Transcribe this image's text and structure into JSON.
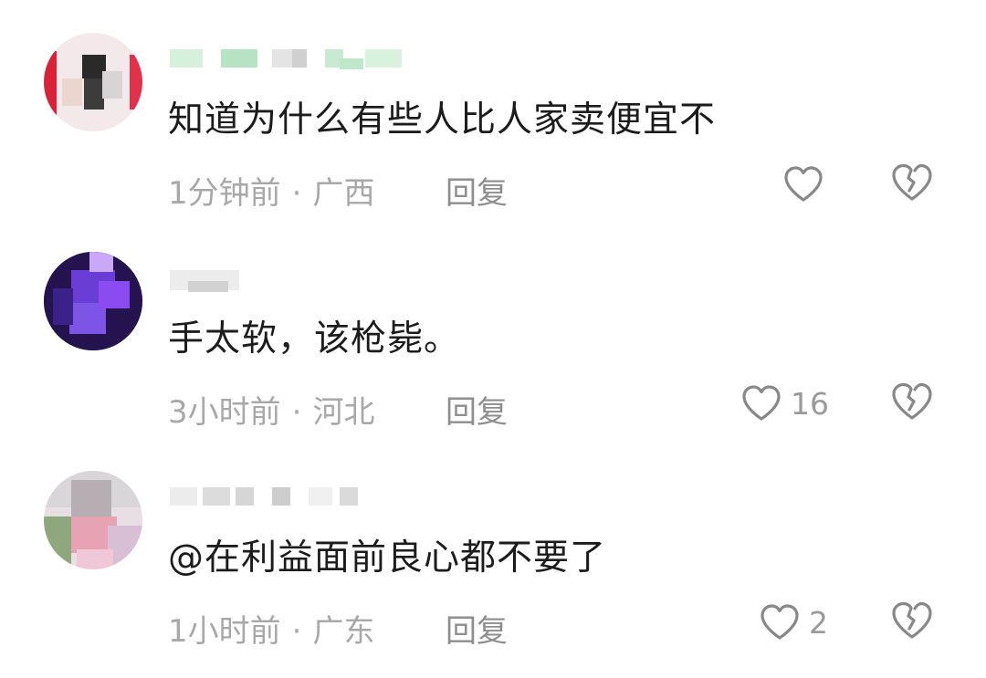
{
  "comments": [
    {
      "content": "知道为什么有些人比人家卖便宜不",
      "time": "1分钟前",
      "separator": "·",
      "location": "广西",
      "reply_label": "回复",
      "like_count": ""
    },
    {
      "content": "手太软，该枪毙。",
      "time": "3小时前",
      "separator": "·",
      "location": "河北",
      "reply_label": "回复",
      "like_count": "16"
    },
    {
      "content": "@在利益面前良心都不要了",
      "time": "1小时前",
      "separator": "·",
      "location": "广东",
      "reply_label": "回复",
      "like_count": "2"
    }
  ],
  "icons": {
    "like": "heart-outline-icon",
    "dislike": "broken-heart-icon"
  },
  "colors": {
    "content_text": "#1c1c1c",
    "meta_text": "#a8a8a8",
    "icon_stroke": "#888888"
  }
}
